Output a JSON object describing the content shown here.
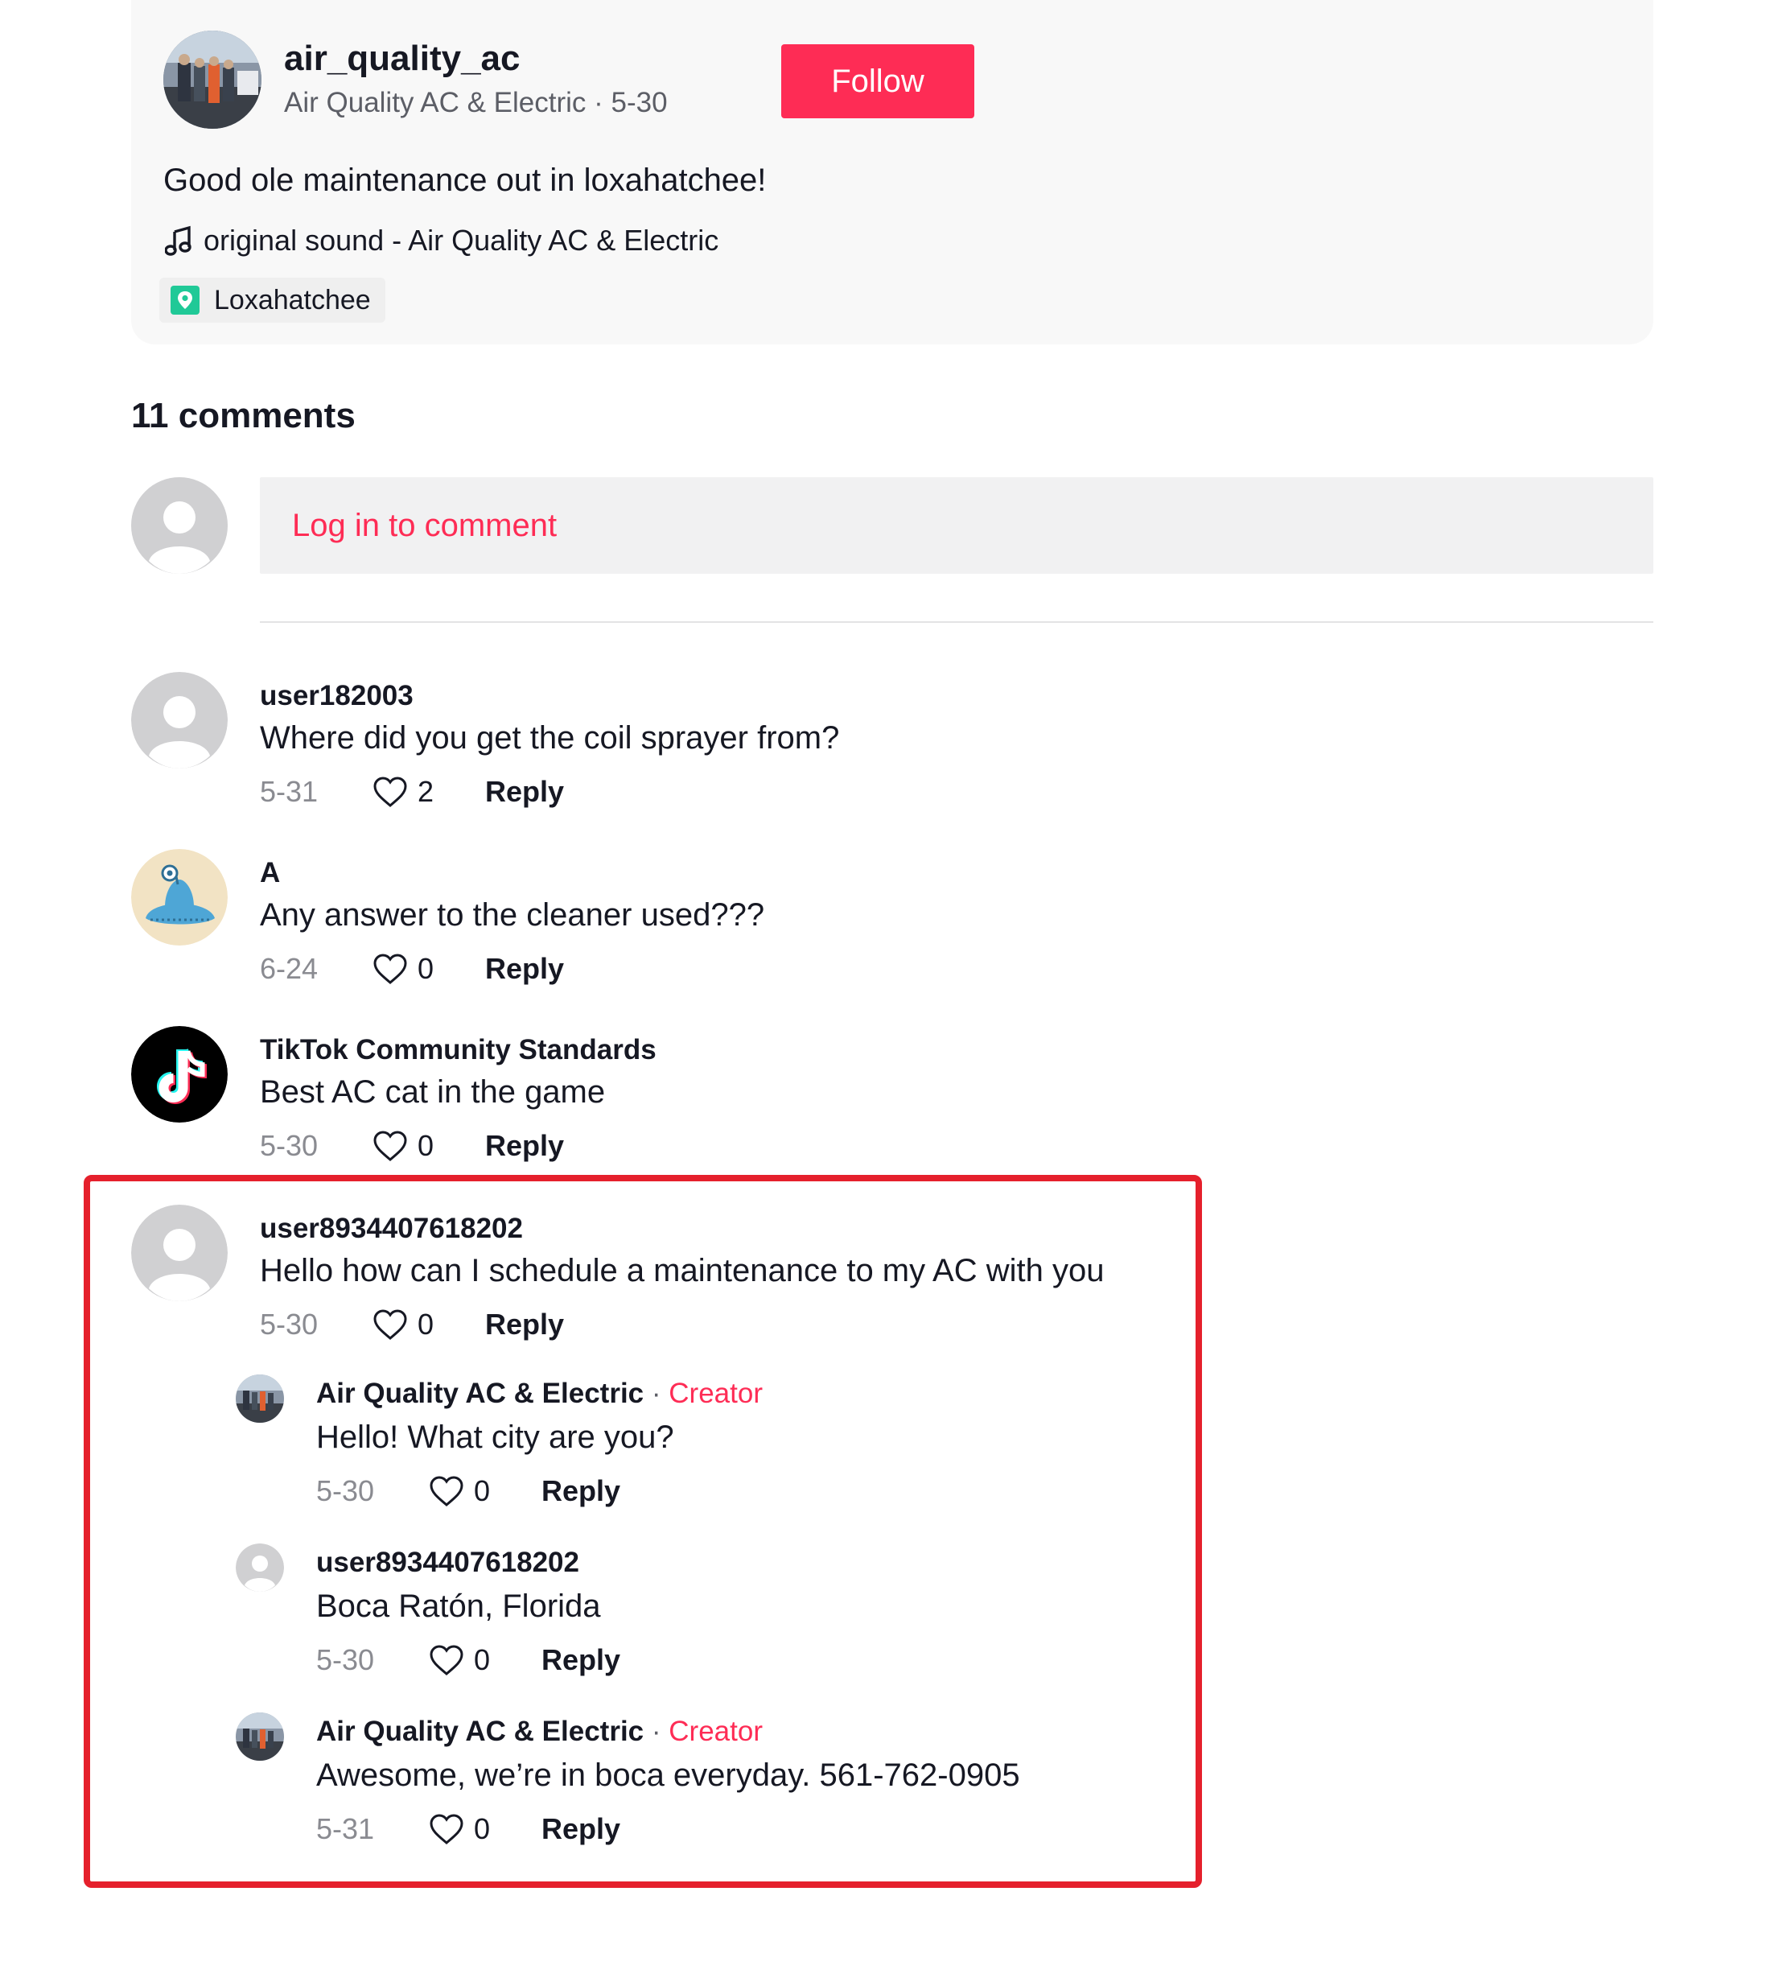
{
  "post": {
    "author_id": "air_quality_ac",
    "author_meta": "Air Quality AC & Electric · 5-30",
    "follow_label": "Follow",
    "caption": "Good ole maintenance out in loxahatchee!",
    "sound": "original sound - Air Quality AC & Electric",
    "location": "Loxahatchee",
    "icons": {
      "sound": "music-note-icon",
      "location": "location-pin-icon"
    },
    "colors": {
      "accent": "#fe2c55",
      "location_pin": "#20c997"
    }
  },
  "comments_header": "11 comments",
  "login_prompt": "Log in to comment",
  "comments": [
    {
      "user": "user182003",
      "text": "Where did you get the coil sprayer from?",
      "date": "5-31",
      "likes": "2",
      "reply_label": "Reply"
    },
    {
      "user": "A",
      "text": "Any answer to the cleaner used???",
      "date": "6-24",
      "likes": "0",
      "reply_label": "Reply"
    },
    {
      "user": "TikTok Community Standards",
      "text": "Best AC cat in the game",
      "date": "5-30",
      "likes": "0",
      "reply_label": "Reply"
    },
    {
      "user": "user8934407618202",
      "text": "Hello how can I schedule a maintenance to my AC with you",
      "date": "5-30",
      "likes": "0",
      "reply_label": "Reply"
    }
  ],
  "replies": [
    {
      "user": "Air Quality AC & Electric",
      "separator": " · ",
      "badge": "Creator",
      "text": "Hello! What city are you?",
      "date": "5-30",
      "likes": "0",
      "reply_label": "Reply"
    },
    {
      "user": "user8934407618202",
      "text": "Boca Ratón, Florida",
      "date": "5-30",
      "likes": "0",
      "reply_label": "Reply"
    },
    {
      "user": "Air Quality AC & Electric",
      "separator": " · ",
      "badge": "Creator",
      "text": "Awesome, we’re in boca everyday. 561-762-0905",
      "date": "5-31",
      "likes": "0",
      "reply_label": "Reply"
    }
  ]
}
